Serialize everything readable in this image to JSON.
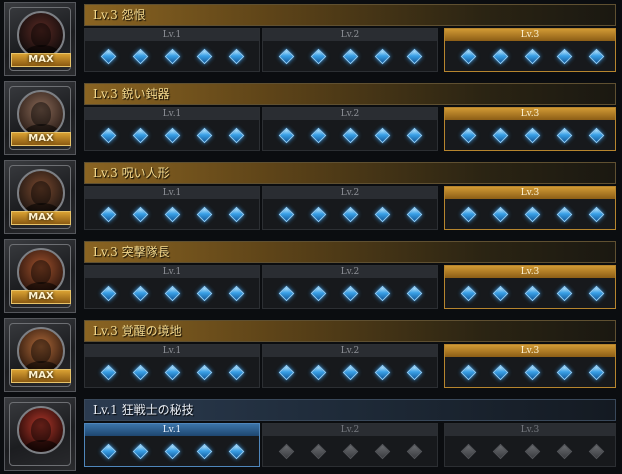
{
  "level_columns": [
    "Lv.1",
    "Lv.2",
    "Lv.3"
  ],
  "skills": [
    {
      "name": "Lv.3 怨恨",
      "badge": "MAX",
      "current_level": 3,
      "colors": [
        "#5a2a24",
        "#0e0a0a"
      ],
      "bar_style": "gold"
    },
    {
      "name": "Lv.3 鋭い鈍器",
      "badge": "MAX",
      "current_level": 3,
      "colors": [
        "#8a6a58",
        "#2a1c16"
      ],
      "bar_style": "gold"
    },
    {
      "name": "Lv.3 呪い人形",
      "badge": "MAX",
      "current_level": 3,
      "colors": [
        "#7a4a30",
        "#1c1410"
      ],
      "bar_style": "gold"
    },
    {
      "name": "Lv.3 突撃隊長",
      "badge": "MAX",
      "current_level": 3,
      "colors": [
        "#a0522d",
        "#2a140c"
      ],
      "bar_style": "gold"
    },
    {
      "name": "Lv.3 覚醒の境地",
      "badge": "MAX",
      "current_level": 3,
      "colors": [
        "#b06a3a",
        "#2b170c"
      ],
      "bar_style": "gold"
    },
    {
      "name": "Lv.1 狂戦士の秘技",
      "badge": "",
      "current_level": 1,
      "colors": [
        "#b2382b",
        "#200806"
      ],
      "bar_style": "blue"
    }
  ],
  "colors": {
    "gold_accent": "#d19a34",
    "blue_accent": "#3b74a8",
    "diamond_active": "#3aa0e6",
    "diamond_locked": "#4a4c50"
  }
}
